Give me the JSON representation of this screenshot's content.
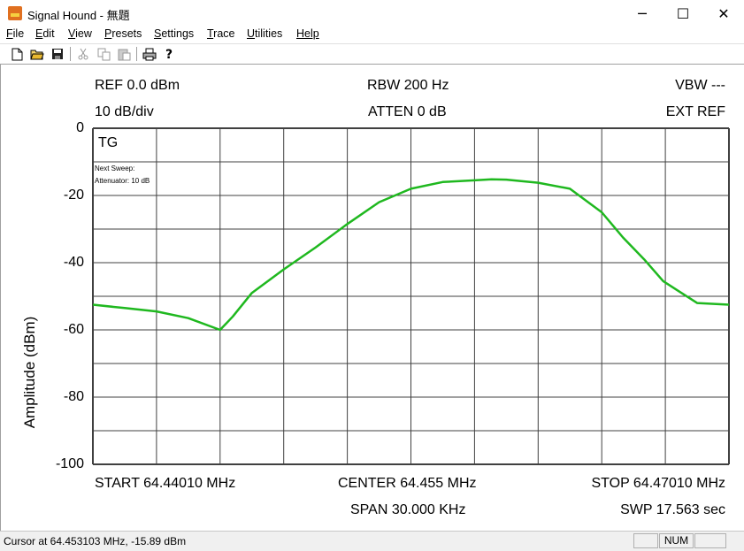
{
  "window": {
    "title": "Signal Hound - 無題",
    "minimize": "─",
    "maximize": "☐",
    "close": "✕"
  },
  "menu": {
    "file": "F",
    "file_rest": "ile",
    "edit": "E",
    "edit_rest": "dit",
    "view": "V",
    "view_rest": "iew",
    "presets": "P",
    "presets_rest": "resets",
    "settings": "S",
    "settings_rest": "ettings",
    "trace": "T",
    "trace_rest": "race",
    "utilities": "U",
    "utilities_rest": "tilities",
    "help": "Help"
  },
  "toolbar": {
    "icons": [
      "new-file-icon",
      "open-folder-icon",
      "save-icon",
      "cut-icon",
      "copy-icon",
      "paste-icon",
      "print-icon",
      "help-icon"
    ]
  },
  "header": {
    "ref": "REF 0.0 dBm",
    "scale": "10 dB/div",
    "rbw": "RBW 200 Hz",
    "atten": "ATTEN 0 dB",
    "vbw": "VBW ---",
    "ext_ref": "EXT REF"
  },
  "footer": {
    "start": "START 64.44010 MHz",
    "center": "CENTER 64.455 MHz",
    "stop": "STOP 64.47010 MHz",
    "span": "SPAN 30.000 KHz",
    "swp": "SWP 17.563 sec"
  },
  "overlay": {
    "tg": "TG",
    "next_sweep": "Next Sweep:",
    "attenuator": "Attenuator: 10 dB"
  },
  "status": {
    "cursor": "Cursor at 64.453103 MHz, -15.89 dBm",
    "num": "NUM"
  },
  "colors": {
    "trace": "#1fb81f",
    "grid": "#404040"
  },
  "chart_data": {
    "type": "line",
    "ylabel": "Amplitude (dBm)",
    "xlabel": "",
    "title": "",
    "ylim": [
      -100,
      0
    ],
    "xlim_mhz": [
      64.4401,
      64.4701
    ],
    "yticks": [
      "0",
      "-20",
      "-40",
      "-60",
      "-80",
      "-100"
    ],
    "grid": true,
    "x_divisions": 10,
    "y_divisions": 10,
    "series": [
      {
        "x": [
          64.4401,
          64.4416,
          64.4431,
          64.4446,
          64.4461,
          64.4467,
          64.4476,
          64.4491,
          64.4506,
          64.4521,
          64.4536,
          64.4551,
          64.4566,
          64.4581,
          64.4589,
          64.4596,
          64.4611,
          64.4626,
          64.4641,
          64.4651,
          64.4661,
          64.467,
          64.4686,
          64.4701
        ],
        "y": [
          -52.5,
          -53.5,
          -54.5,
          -56.5,
          -60.0,
          -56.0,
          -49.0,
          -42.0,
          -35.5,
          -28.5,
          -22.0,
          -18.0,
          -16.0,
          -15.5,
          -15.2,
          -15.3,
          -16.2,
          -18.0,
          -25.0,
          -32.5,
          -39.0,
          -45.5,
          -52.0,
          -52.5
        ]
      }
    ]
  }
}
